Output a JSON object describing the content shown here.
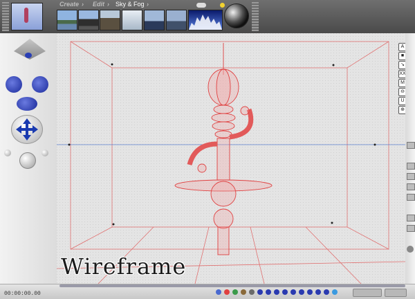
{
  "menu": {
    "create": "Create",
    "edit": "Edit",
    "current": "Sky & Fog"
  },
  "sky_presets": [
    "mountain-lake",
    "dark-peaks",
    "cliffs",
    "haze",
    "ocean",
    "coast",
    "blue-gradient"
  ],
  "viewport": {
    "mode_label": "Wireframe"
  },
  "timeline": {
    "timecode": "00:00:00.00"
  },
  "right_toolbar": [
    "A",
    "■",
    "↘",
    "XX",
    "M",
    "⊖",
    "U",
    "⊕"
  ],
  "colors": {
    "wireframe": "#e04040",
    "accent_blue": "#2a3fb5",
    "horizon": "#5a7fd0"
  },
  "icons": {
    "sun": "sun-icon",
    "moon": "moon-icon",
    "cloud": "cloud-icon",
    "move": "move-arrows-icon"
  }
}
